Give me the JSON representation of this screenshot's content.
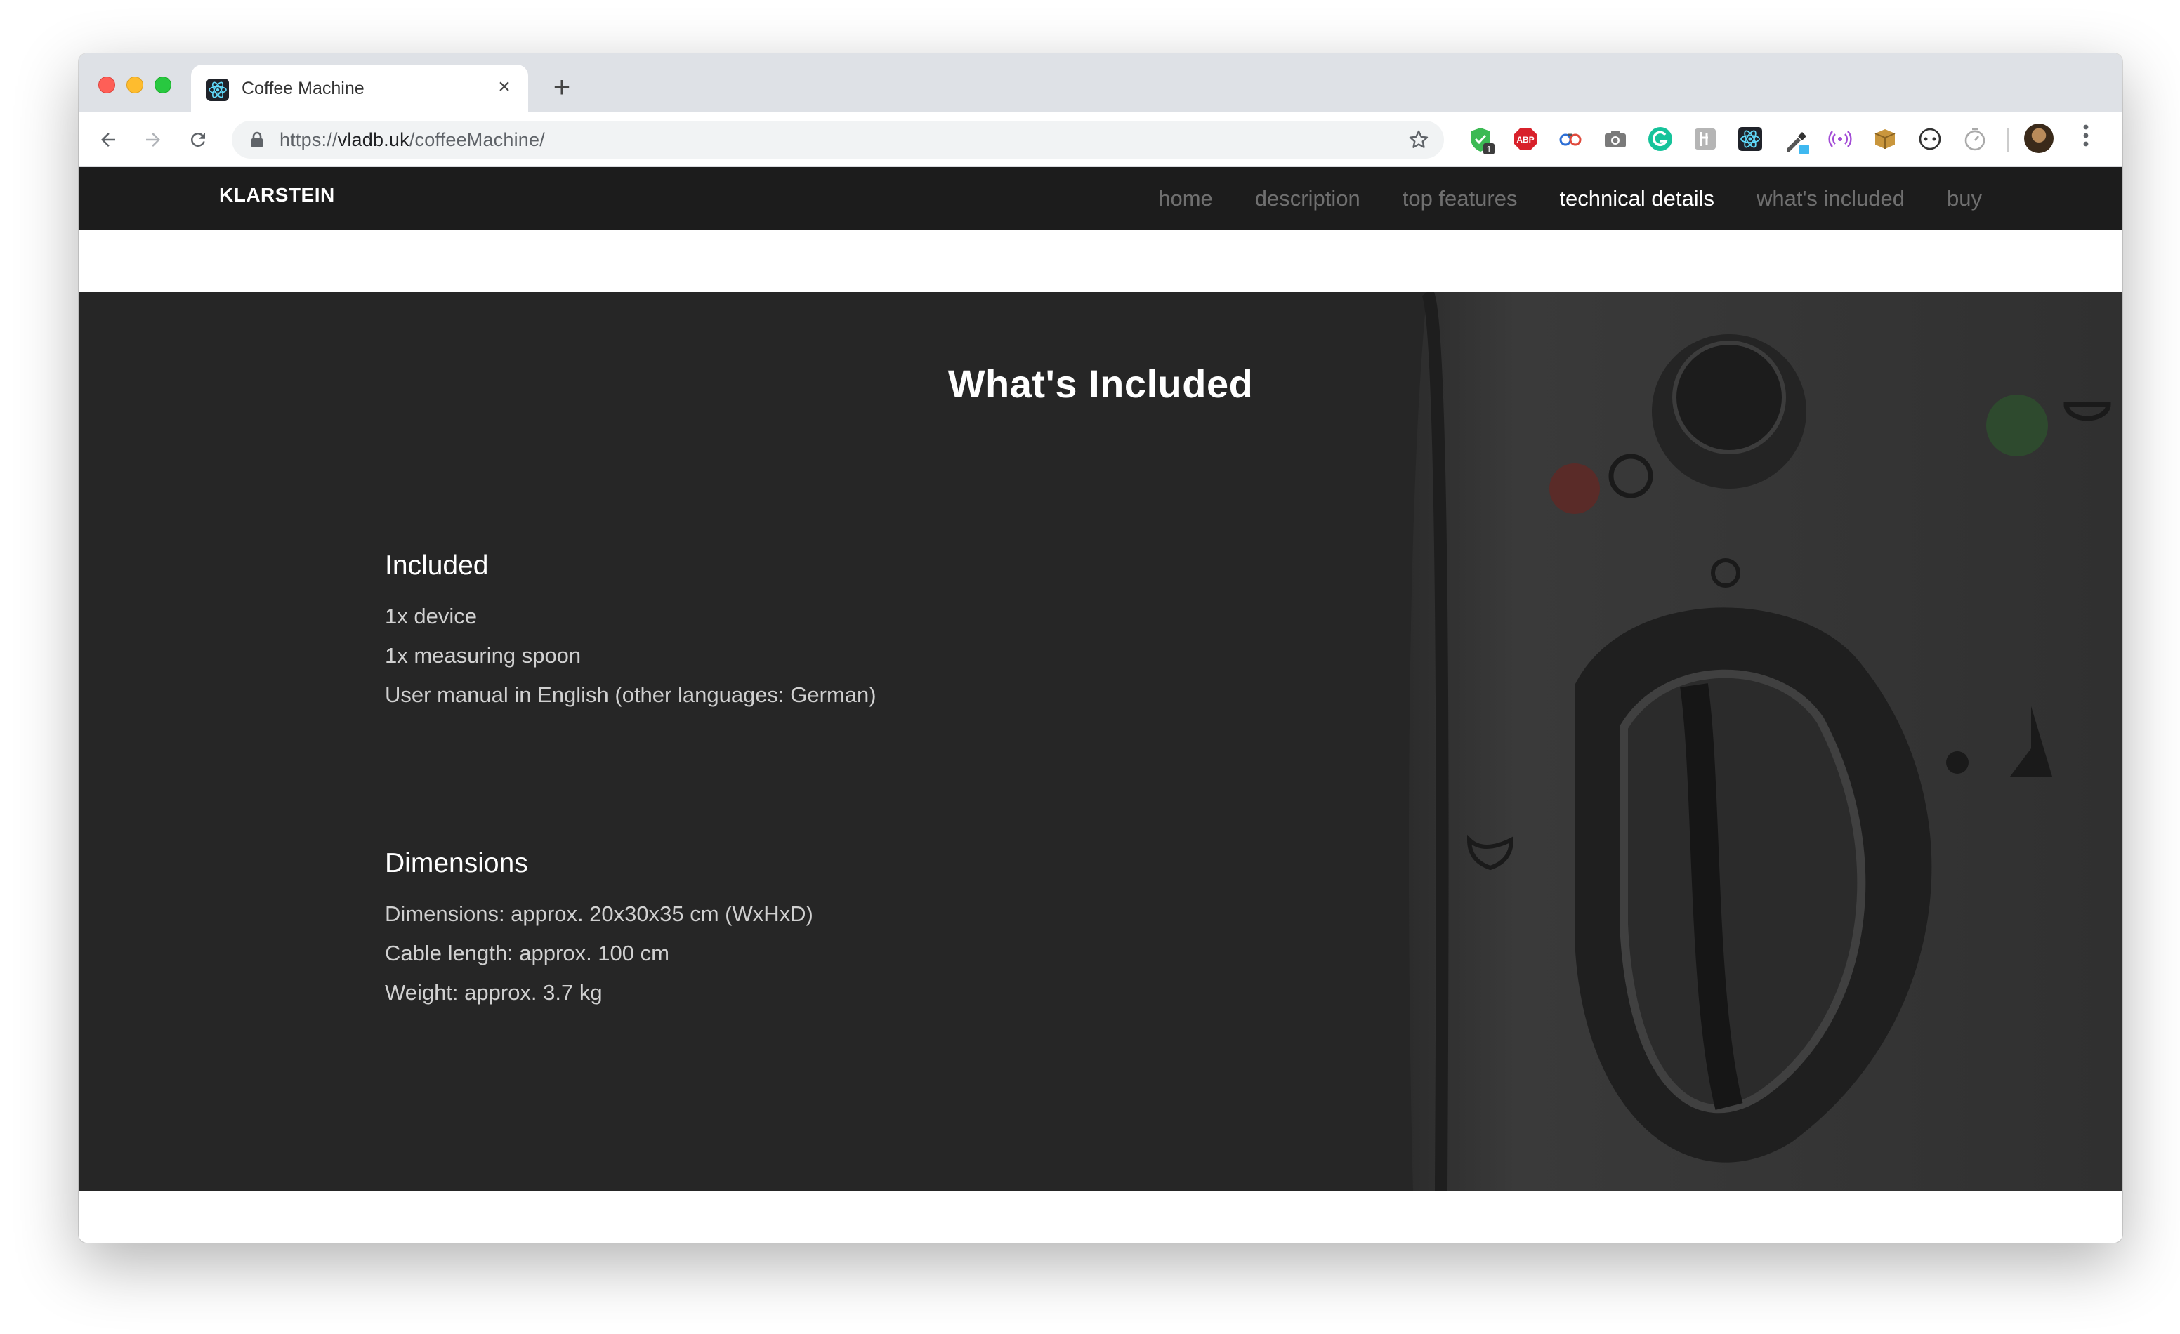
{
  "browser": {
    "tab_title": "Coffee Machine",
    "close_glyph": "×",
    "newtab_glyph": "+",
    "url_scheme": "https://",
    "url_host": "vladb.uk",
    "url_path": "/coffeeMachine/",
    "extensions": [
      "shield-badge-icon",
      "adblock-icon",
      "glasses-icon",
      "camera-icon",
      "grammarly-icon",
      "tag-icon",
      "react-devtools-icon",
      "eyedropper-icon",
      "radio-icon",
      "package-icon",
      "circle-icon",
      "timer-icon"
    ],
    "extension_badge": "1",
    "extension_abp_label": "ABP"
  },
  "site": {
    "brand": "KLARSTEIN",
    "nav": [
      {
        "label": "home",
        "active": false
      },
      {
        "label": "description",
        "active": false
      },
      {
        "label": "top features",
        "active": false
      },
      {
        "label": "technical details",
        "active": true
      },
      {
        "label": "what's included",
        "active": false
      },
      {
        "label": "buy",
        "active": false
      }
    ]
  },
  "content": {
    "title": "What's Included",
    "sections": [
      {
        "heading": "Included",
        "lines": [
          "1x device",
          "1x measuring spoon",
          "User manual in English (other languages: German)"
        ]
      },
      {
        "heading": "Dimensions",
        "lines": [
          "Dimensions: approx. 20x30x35 cm (WxHxD)",
          "Cable length: approx. 100 cm",
          "Weight: approx. 3.7 kg"
        ]
      }
    ]
  },
  "colors": {
    "nav_bg": "#1c1c1c",
    "section_bg": "#262626",
    "active_link": "#ffffff",
    "inactive_link": "#6f6f6f"
  }
}
